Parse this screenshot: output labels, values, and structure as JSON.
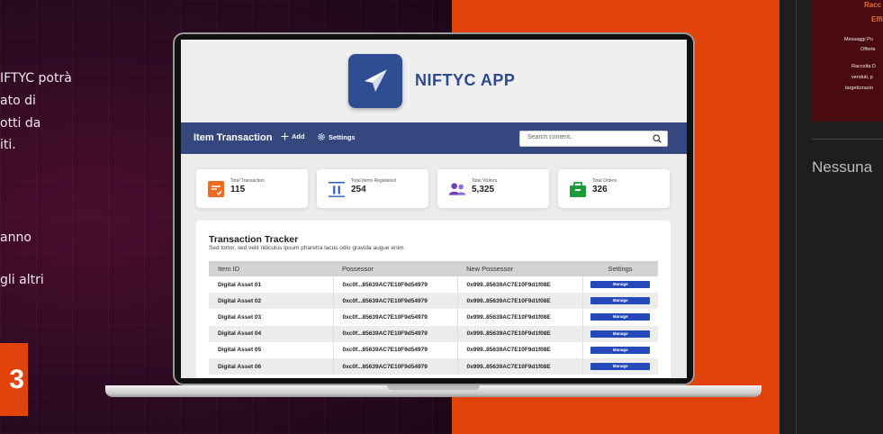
{
  "background": {
    "left_text_lines": [
      "IFTYC potrà",
      "ato di",
      "otti da",
      "iti.",
      "anno",
      "gli altri"
    ],
    "left_badge": "3"
  },
  "sidebar_right": {
    "promo_title_1": "Racc",
    "promo_title_2": "Effi",
    "promo_line_1": "Messaggi Pu",
    "promo_line_2": "Offerte",
    "promo_line_3": "Raccolta D",
    "promo_line_4": "venduti, p",
    "promo_line_5": "targetizzazio",
    "empty_text": "Nessuna"
  },
  "app": {
    "name": "NIFTYC APP",
    "brand_color": "#2c4a8e"
  },
  "navbar": {
    "title": "Item Transaction",
    "add_label": "Add",
    "settings_label": "Settings",
    "search_placeholder": "Search content.."
  },
  "stats": [
    {
      "label": "Total Transaction",
      "value": "115",
      "icon": "transaction-icon",
      "color": "#ee6a20"
    },
    {
      "label": "Total Items Registered",
      "value": "254",
      "icon": "items-icon",
      "color": "#2a5bb5"
    },
    {
      "label": "Total Visitors",
      "value": "5,325",
      "icon": "visitors-icon",
      "color": "#6b3fbf"
    },
    {
      "label": "Total Orders",
      "value": "326",
      "icon": "orders-icon",
      "color": "#1f9a3b"
    }
  ],
  "tracker": {
    "title": "Transaction Tracker",
    "subtitle": "Sed tortor, sed velit ridiculus ipsum pharetra lacus odio gravida augue enim.",
    "columns": [
      "Item ID",
      "Possessor",
      "New Possessor",
      "Settings"
    ],
    "manage_label": "Manage",
    "rows": [
      {
        "id": "Digital Asset 01",
        "possessor": "0xc0f...85639AC7E10F9d54979",
        "new_possessor": "0x999..85639AC7E10F9d1f08E"
      },
      {
        "id": "Digital Asset 02",
        "possessor": "0xc0f...85639AC7E10F9d54979",
        "new_possessor": "0x999..85639AC7E10F9d1f08E"
      },
      {
        "id": "Digital Asset 03",
        "possessor": "0xc0f...85639AC7E10F9d54979",
        "new_possessor": "0x999..85639AC7E10F9d1f08E"
      },
      {
        "id": "Digital Asset 04",
        "possessor": "0xc0f...85639AC7E10F9d54979",
        "new_possessor": "0x999..85639AC7E10F9d1f08E"
      },
      {
        "id": "Digital Asset 05",
        "possessor": "0xc0f...85639AC7E10F9d54979",
        "new_possessor": "0x999..85639AC7E10F9d1f08E"
      },
      {
        "id": "Digital Asset 06",
        "possessor": "0xc0f...85639AC7E10F9d54979",
        "new_possessor": "0x999..85639AC7E10F9d1f08E"
      }
    ]
  }
}
